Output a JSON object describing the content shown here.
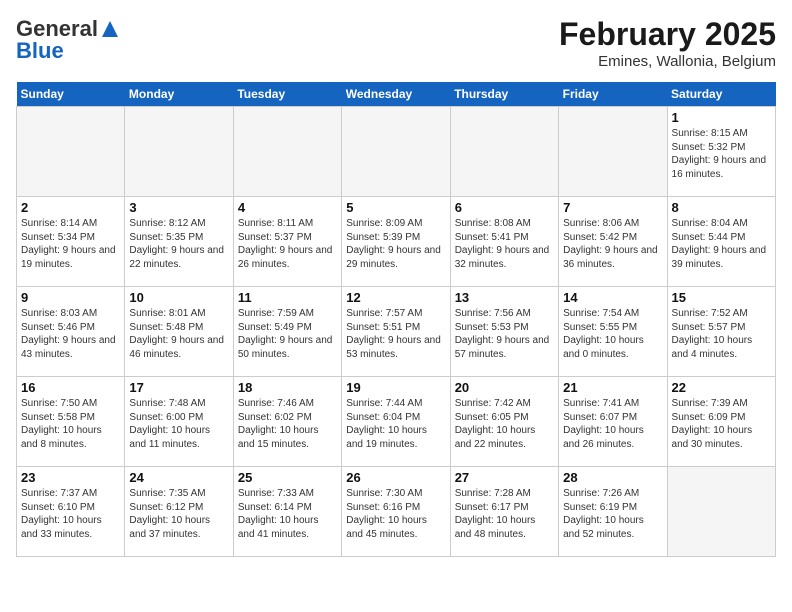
{
  "header": {
    "logo_general": "General",
    "logo_blue": "Blue",
    "month_title": "February 2025",
    "location": "Emines, Wallonia, Belgium"
  },
  "calendar": {
    "days_of_week": [
      "Sunday",
      "Monday",
      "Tuesday",
      "Wednesday",
      "Thursday",
      "Friday",
      "Saturday"
    ],
    "weeks": [
      [
        {
          "day": "",
          "empty": true
        },
        {
          "day": "",
          "empty": true
        },
        {
          "day": "",
          "empty": true
        },
        {
          "day": "",
          "empty": true
        },
        {
          "day": "",
          "empty": true
        },
        {
          "day": "",
          "empty": true
        },
        {
          "day": "1",
          "detail": "Sunrise: 8:15 AM\nSunset: 5:32 PM\nDaylight: 9 hours and 16 minutes."
        }
      ],
      [
        {
          "day": "2",
          "detail": "Sunrise: 8:14 AM\nSunset: 5:34 PM\nDaylight: 9 hours and 19 minutes."
        },
        {
          "day": "3",
          "detail": "Sunrise: 8:12 AM\nSunset: 5:35 PM\nDaylight: 9 hours and 22 minutes."
        },
        {
          "day": "4",
          "detail": "Sunrise: 8:11 AM\nSunset: 5:37 PM\nDaylight: 9 hours and 26 minutes."
        },
        {
          "day": "5",
          "detail": "Sunrise: 8:09 AM\nSunset: 5:39 PM\nDaylight: 9 hours and 29 minutes."
        },
        {
          "day": "6",
          "detail": "Sunrise: 8:08 AM\nSunset: 5:41 PM\nDaylight: 9 hours and 32 minutes."
        },
        {
          "day": "7",
          "detail": "Sunrise: 8:06 AM\nSunset: 5:42 PM\nDaylight: 9 hours and 36 minutes."
        },
        {
          "day": "8",
          "detail": "Sunrise: 8:04 AM\nSunset: 5:44 PM\nDaylight: 9 hours and 39 minutes."
        }
      ],
      [
        {
          "day": "9",
          "detail": "Sunrise: 8:03 AM\nSunset: 5:46 PM\nDaylight: 9 hours and 43 minutes."
        },
        {
          "day": "10",
          "detail": "Sunrise: 8:01 AM\nSunset: 5:48 PM\nDaylight: 9 hours and 46 minutes."
        },
        {
          "day": "11",
          "detail": "Sunrise: 7:59 AM\nSunset: 5:49 PM\nDaylight: 9 hours and 50 minutes."
        },
        {
          "day": "12",
          "detail": "Sunrise: 7:57 AM\nSunset: 5:51 PM\nDaylight: 9 hours and 53 minutes."
        },
        {
          "day": "13",
          "detail": "Sunrise: 7:56 AM\nSunset: 5:53 PM\nDaylight: 9 hours and 57 minutes."
        },
        {
          "day": "14",
          "detail": "Sunrise: 7:54 AM\nSunset: 5:55 PM\nDaylight: 10 hours and 0 minutes."
        },
        {
          "day": "15",
          "detail": "Sunrise: 7:52 AM\nSunset: 5:57 PM\nDaylight: 10 hours and 4 minutes."
        }
      ],
      [
        {
          "day": "16",
          "detail": "Sunrise: 7:50 AM\nSunset: 5:58 PM\nDaylight: 10 hours and 8 minutes."
        },
        {
          "day": "17",
          "detail": "Sunrise: 7:48 AM\nSunset: 6:00 PM\nDaylight: 10 hours and 11 minutes."
        },
        {
          "day": "18",
          "detail": "Sunrise: 7:46 AM\nSunset: 6:02 PM\nDaylight: 10 hours and 15 minutes."
        },
        {
          "day": "19",
          "detail": "Sunrise: 7:44 AM\nSunset: 6:04 PM\nDaylight: 10 hours and 19 minutes."
        },
        {
          "day": "20",
          "detail": "Sunrise: 7:42 AM\nSunset: 6:05 PM\nDaylight: 10 hours and 22 minutes."
        },
        {
          "day": "21",
          "detail": "Sunrise: 7:41 AM\nSunset: 6:07 PM\nDaylight: 10 hours and 26 minutes."
        },
        {
          "day": "22",
          "detail": "Sunrise: 7:39 AM\nSunset: 6:09 PM\nDaylight: 10 hours and 30 minutes."
        }
      ],
      [
        {
          "day": "23",
          "detail": "Sunrise: 7:37 AM\nSunset: 6:10 PM\nDaylight: 10 hours and 33 minutes."
        },
        {
          "day": "24",
          "detail": "Sunrise: 7:35 AM\nSunset: 6:12 PM\nDaylight: 10 hours and 37 minutes."
        },
        {
          "day": "25",
          "detail": "Sunrise: 7:33 AM\nSunset: 6:14 PM\nDaylight: 10 hours and 41 minutes."
        },
        {
          "day": "26",
          "detail": "Sunrise: 7:30 AM\nSunset: 6:16 PM\nDaylight: 10 hours and 45 minutes."
        },
        {
          "day": "27",
          "detail": "Sunrise: 7:28 AM\nSunset: 6:17 PM\nDaylight: 10 hours and 48 minutes."
        },
        {
          "day": "28",
          "detail": "Sunrise: 7:26 AM\nSunset: 6:19 PM\nDaylight: 10 hours and 52 minutes."
        },
        {
          "day": "",
          "empty": true
        }
      ]
    ]
  }
}
